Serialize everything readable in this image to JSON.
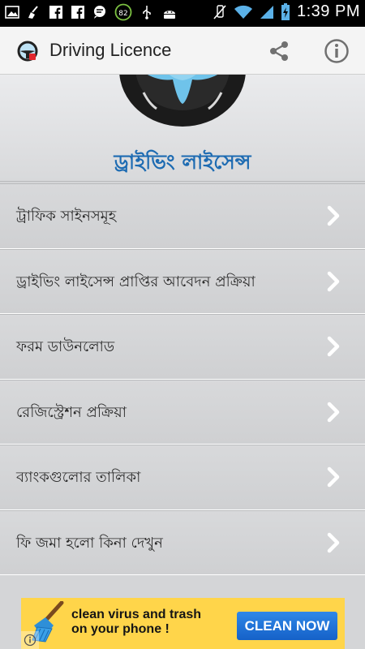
{
  "status_bar": {
    "time": "1:39",
    "time_suffix": "PM",
    "battery_indicator": "82",
    "icons": [
      "gallery-icon",
      "broom-icon",
      "facebook-icon",
      "facebook-icon",
      "chat-icon",
      "speed-icon",
      "usb-icon",
      "android-icon",
      "mute-icon",
      "wifi-icon",
      "signal-icon",
      "battery-icon"
    ]
  },
  "action_bar": {
    "title": "Driving Licence",
    "share_icon": "share-icon",
    "info_icon": "info-icon"
  },
  "header": {
    "title": "ড্রাইভিং লাইসেন্স"
  },
  "menu": {
    "items": [
      {
        "label": "ট্রাফিক সাইনসমূহ"
      },
      {
        "label": "ড্রাইভিং লাইসেন্স প্রাপ্তির আবেদন প্রক্রিয়া"
      },
      {
        "label": "ফরম ডাউনলোড"
      },
      {
        "label": "রেজিস্ট্রেশন প্রক্রিয়া"
      },
      {
        "label": "ব্যাংকগুলোর তালিকা"
      },
      {
        "label": "ফি জমা হলো কিনা দেখুন"
      }
    ]
  },
  "ad": {
    "line1": "clean virus and trash",
    "line2": "on your phone !",
    "button": "CLEAN NOW",
    "colors": {
      "background": "#ffd54a",
      "button": "#1f73d8"
    }
  },
  "colors": {
    "accent": "#1d6bb2",
    "statusbar": "#000000",
    "actionbar": "#f4f4f4",
    "list_bg": "#d4d5d7"
  }
}
